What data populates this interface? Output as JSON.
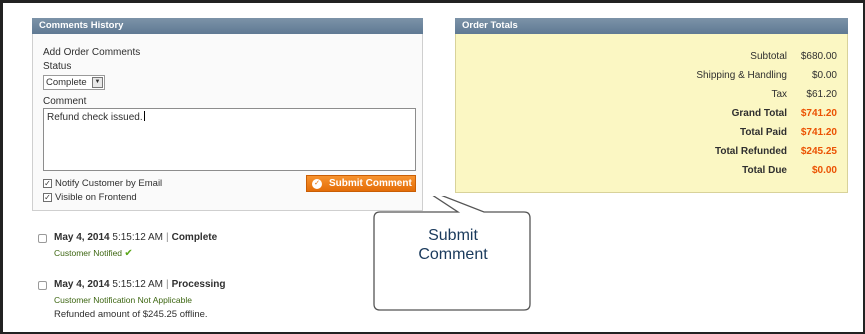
{
  "comments": {
    "title": "Comments History",
    "add_label": "Add Order Comments",
    "status_label": "Status",
    "status_value": "Complete",
    "comment_label": "Comment",
    "comment_value": "Refund check issued.",
    "notify_label": "Notify Customer by Email",
    "visible_label": "Visible on Frontend",
    "submit_label": "Submit Comment"
  },
  "history": [
    {
      "date": "May 4, 2014",
      "time": "5:15:12 AM",
      "status": "Complete",
      "note_prefix": "Customer",
      "note": "Notified",
      "extra": ""
    },
    {
      "date": "May 4, 2014",
      "time": "5:15:12 AM",
      "status": "Processing",
      "note_prefix": "",
      "note": "Customer Notification Not Applicable",
      "extra": "Refunded amount of $245.25 offline."
    }
  ],
  "totals": {
    "title": "Order Totals",
    "rows": [
      {
        "label": "Subtotal",
        "value": "$680.00"
      },
      {
        "label": "Shipping & Handling",
        "value": "$0.00"
      },
      {
        "label": "Tax",
        "value": "$61.20"
      },
      {
        "label": "Grand Total",
        "value": "$741.20"
      },
      {
        "label": "Total Paid",
        "value": "$741.20"
      },
      {
        "label": "Total Refunded",
        "value": "$245.25"
      },
      {
        "label": "Total Due",
        "value": "$0.00"
      }
    ]
  },
  "callout": {
    "line1": "Submit",
    "line2": "Comment"
  },
  "colors": {
    "accent": "#eb5202",
    "header": "#6a8399",
    "totals_bg": "#fbf7c3",
    "notified": "#3d6611"
  }
}
